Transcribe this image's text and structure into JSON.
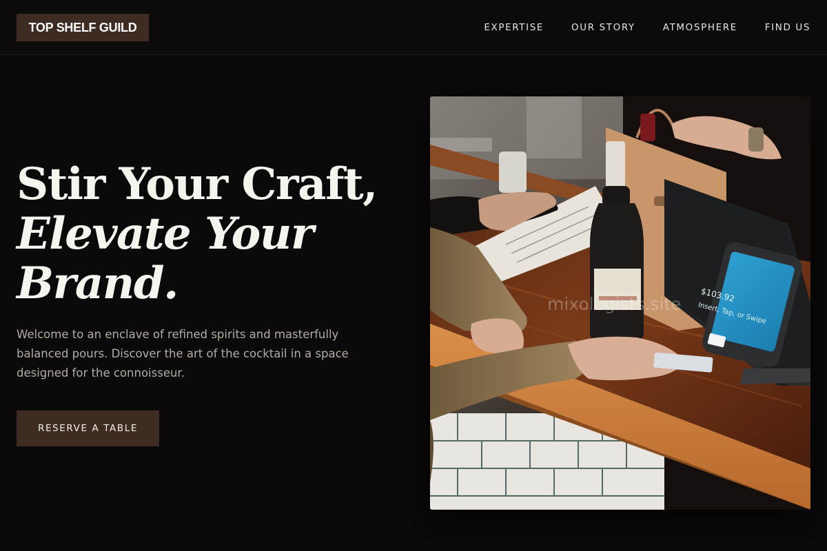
{
  "header": {
    "logo": "TOP SHELF GUILD",
    "nav": [
      {
        "label": "EXPERTISE"
      },
      {
        "label": "OUR STORY"
      },
      {
        "label": "ATMOSPHERE"
      },
      {
        "label": "FIND US"
      }
    ]
  },
  "hero": {
    "headline_line1": "Stir Your Craft,",
    "headline_line2": "Elevate Your",
    "headline_line3": "Brand.",
    "description": "Welcome to an enclave of refined spirits and masterfully balanced pours. Discover the art of the cocktail in a space designed for the connoisseur.",
    "cta_label": "RESERVE A TABLE"
  },
  "photo": {
    "watermark": "mixologists.site",
    "terminal_amount": "$103.92",
    "terminal_prompt": "Insert, Tap, or Swipe"
  },
  "colors": {
    "background": "#0b0909",
    "accent": "#3e2b22",
    "text": "#f2eee9",
    "muted_text": "#b4ada6"
  }
}
